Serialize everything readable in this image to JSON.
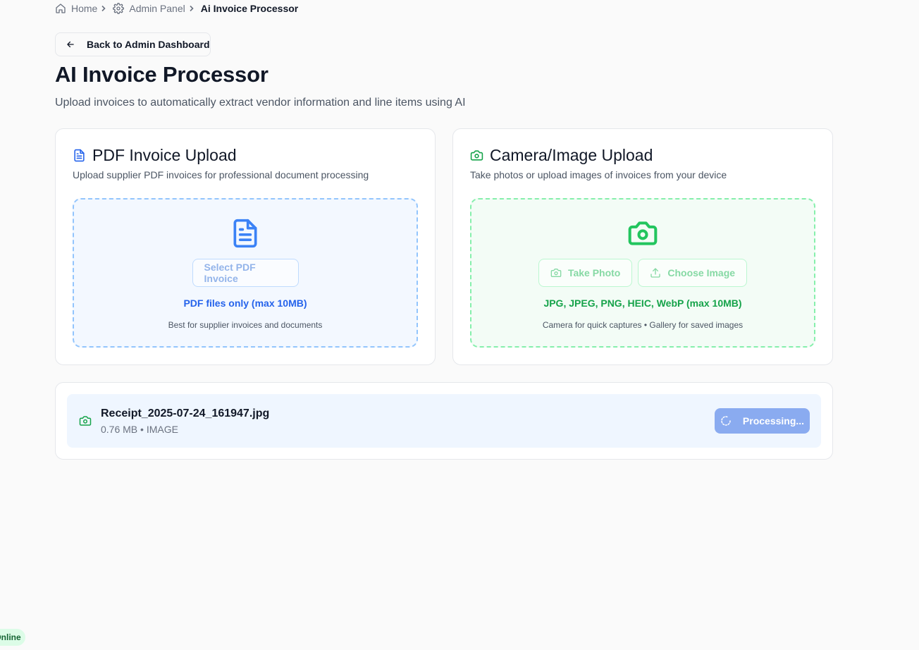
{
  "breadcrumb": {
    "items": [
      {
        "label": "Home",
        "icon": "home-icon"
      },
      {
        "label": "Admin Panel",
        "icon": "gear-icon"
      },
      {
        "label": "Ai Invoice Processor"
      }
    ]
  },
  "back_button": {
    "label": "Back to Admin Dashboard",
    "icon": "arrow-left-icon"
  },
  "page": {
    "title": "AI Invoice Processor",
    "subtitle": "Upload invoices to automatically extract vendor information and line items using AI"
  },
  "pdf_upload": {
    "title": "PDF Invoice Upload",
    "description": "Upload supplier PDF invoices for professional document processing",
    "button_label": "Select PDF Invoice",
    "formats": "PDF files only (max 10MB)",
    "hint": "Best for supplier invoices and documents",
    "icon": "file-text-icon",
    "accent_color": "#2563eb"
  },
  "image_upload": {
    "title": "Camera/Image Upload",
    "description": "Take photos or upload images of invoices from your device",
    "take_photo_label": "Take Photo",
    "choose_image_label": "Choose Image",
    "formats": "JPG, JPEG, PNG, HEIC, WebP (max 10MB)",
    "hint": "Camera for quick captures • Gallery for saved images",
    "icon": "camera-icon",
    "accent_color": "#16a34a"
  },
  "upload_queue": {
    "file": {
      "name": "Receipt_2025-07-24_161947.jpg",
      "meta": "0.76 MB • IMAGE",
      "icon": "camera-icon"
    },
    "status_button": "Processing..."
  },
  "connection_status": "Online"
}
